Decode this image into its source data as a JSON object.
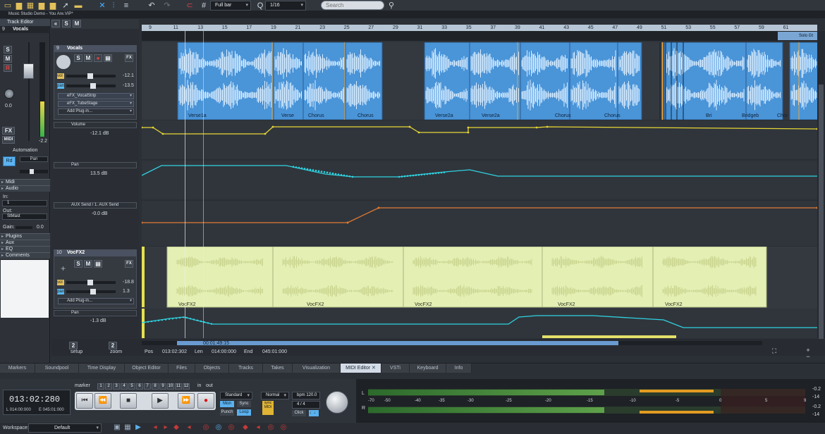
{
  "title_bar": {
    "text": "Music Studio Demo - You Are.VIP*"
  },
  "toolbar": {
    "snap_value": "Full bar",
    "quantize_value": "1/16",
    "search_placeholder": "Search"
  },
  "track_editor": {
    "title": "Track Editor",
    "track_number": "9",
    "track_name": "Vocals",
    "s": "S",
    "m": "M",
    "r": "R",
    "fx": "FX",
    "midi": "MIDI",
    "fader_value": "0.0",
    "meter_value": "-2.2",
    "automation_label": "Automation",
    "rd_label": "Rd",
    "pan_label": "Pan",
    "sections": [
      "Midi",
      "Audio",
      "Plugins",
      "Aux",
      "EQ",
      "Comments"
    ],
    "in_label": "In:",
    "in_value": "1",
    "out_label": "Out:",
    "out_value": "StMast",
    "gain_label": "Gain:",
    "gain_value": "0.0"
  },
  "tracks": {
    "vocals": {
      "number": "9",
      "name": "Vocals",
      "vol_label": "vol",
      "vol_value": "-12.1",
      "pan_label": "pan",
      "pan_value": "-13.5",
      "fx1": "eFX_VocalStrip",
      "fx2": "eFX_TubeStage",
      "add_plugin": "Add Plug-in...",
      "auto_volume_name": "Volume",
      "auto_volume_value": "-12.1 dB",
      "auto_pan_name": "Pan",
      "auto_pan_value": "13.5 dB",
      "auto_aux_name": "AUX Send / 1. AUX Send",
      "auto_aux_value": "-0.0 dB"
    },
    "vocfx2": {
      "number": "10",
      "name": "VocFX2",
      "vol_label": "vol",
      "vol_value": "-18.8",
      "pan_label": "pan",
      "pan_value": "1.3",
      "add_plugin": "Add Plug-in...",
      "auto_pan_name": "Pan",
      "auto_pan_value": "-1.3 dB"
    }
  },
  "ruler": {
    "numbers": [
      "9",
      "11",
      "13",
      "15",
      "17",
      "19",
      "21",
      "23",
      "25",
      "27",
      "29",
      "31",
      "33",
      "35",
      "37",
      "39",
      "41",
      "43",
      "45",
      "47",
      "49",
      "51",
      "53",
      "55",
      "57",
      "59",
      "61"
    ],
    "marker_label": "Solo Gt"
  },
  "clips": {
    "vocals": [
      "Verse1a",
      "Verse",
      "Chorus",
      "Chorus",
      "Verse2a",
      "Verse2a",
      "Chorus",
      "Chorus",
      "Bri",
      "Bridgeb",
      "Chor"
    ],
    "vocfx2": [
      "VocFX2",
      "VocFX2",
      "VocFX2",
      "VocFX2",
      "VocFX2"
    ]
  },
  "status_bar": {
    "setup_label": "setup",
    "zoom_label": "zoom",
    "setup_value": "2",
    "zoom_value": "2",
    "pos_label": "Pos",
    "pos_value": "013:02:302",
    "len_label": "Len",
    "len_value": "014:00:000",
    "end_label": "End",
    "end_value": "045:01:000",
    "timeline_readout": "00:01:49:15"
  },
  "tabs": [
    "Markers",
    "Soundpool",
    "Time Display",
    "Object Editor",
    "Files",
    "Objects",
    "Tracks",
    "Takes",
    "Visualization",
    "MIDI Editor",
    "VSTi",
    "Keyboard",
    "Info"
  ],
  "transport": {
    "time": "013:02:280",
    "sub_left": "L 014:00:000",
    "sub_right": "E 045:01:000",
    "marker_label": "marker",
    "markers": [
      "1",
      "2",
      "3",
      "4",
      "5",
      "6",
      "7",
      "8",
      "9",
      "10",
      "11",
      "12"
    ],
    "in_label": "in",
    "out_label": "out",
    "mode": "Standard",
    "mon": "Mon",
    "sync": "Sync",
    "punch": "Punch",
    "loop": "Loop",
    "play_mode": "Normal",
    "bpm": "bpm 120.0",
    "signature": "4 / 4",
    "click": "Click"
  },
  "meter": {
    "left_label": "L",
    "right_label": "R",
    "scale": [
      "-70",
      "-50",
      "-40",
      "-35",
      "-30",
      "-25",
      "-20",
      "-15",
      "-10",
      "-5",
      "0",
      "5",
      "9"
    ],
    "peak_left_top": "-0.2",
    "peak_left_bottom": "-14",
    "peak_right_top": "-0.2",
    "peak_right_bottom": "-14"
  },
  "workspace": {
    "label": "Workspace:",
    "value": "Default"
  },
  "colors": {
    "clip_blue": "#4a94d8",
    "clip_yellow": "#e4efb4",
    "volume_line": "#e6d634",
    "pan_line": "#2fd3e0",
    "aux_line": "#e07a32"
  }
}
